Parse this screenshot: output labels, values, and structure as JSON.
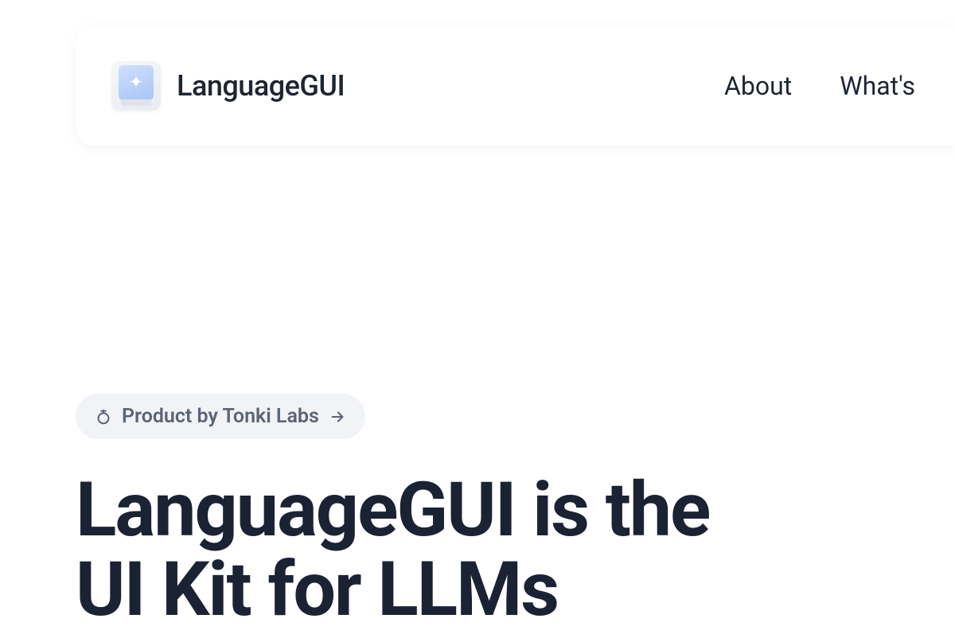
{
  "navbar": {
    "brand_name": "LanguageGUI",
    "links": [
      {
        "label": "About"
      },
      {
        "label": "What's"
      }
    ]
  },
  "hero": {
    "badge": {
      "text": "Product by Tonki Labs"
    },
    "title_line1": "LanguageGUI is the",
    "title_line2": "UI Kit for LLMs"
  }
}
